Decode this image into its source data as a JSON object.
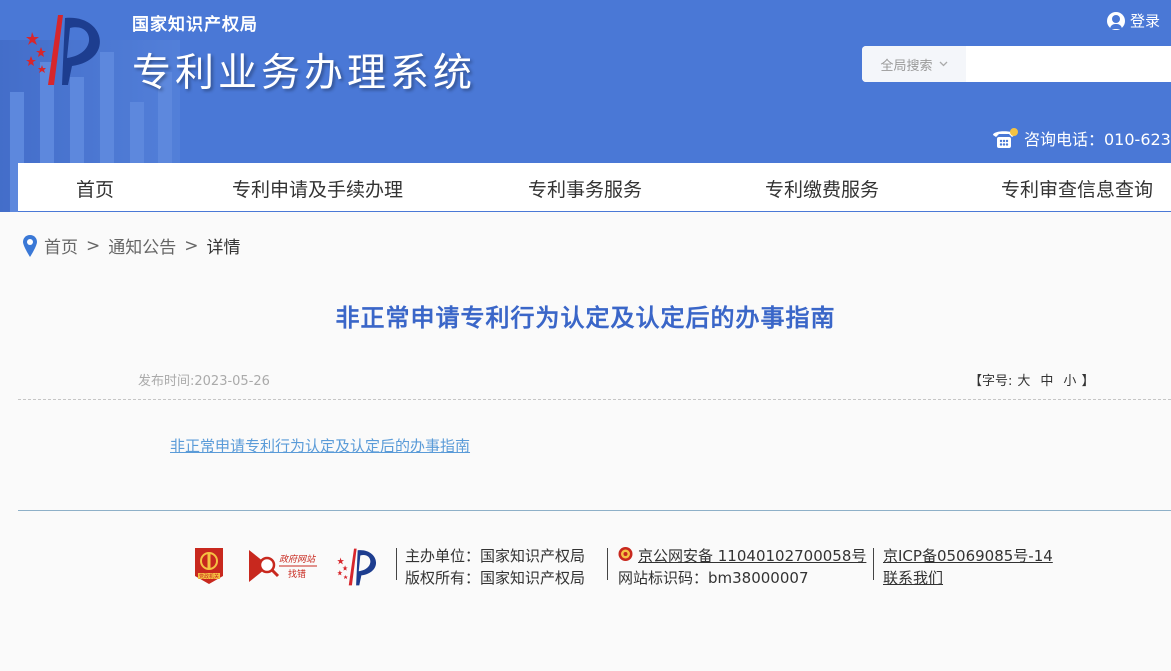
{
  "header": {
    "org_name": "国家知识产权局",
    "system_name": "专利业务办理系统",
    "login_label": "登录",
    "search": {
      "scope_label": "全局搜索",
      "placeholder": ""
    },
    "phone_label": "咨询电话：010-623"
  },
  "nav": {
    "items": [
      {
        "label": "首页"
      },
      {
        "label": "专利申请及手续办理"
      },
      {
        "label": "专利事务服务"
      },
      {
        "label": "专利缴费服务"
      },
      {
        "label": "专利审查信息查询"
      }
    ]
  },
  "breadcrumb": {
    "home": "首页",
    "section": "通知公告",
    "current": "详情",
    "separator": ">"
  },
  "article": {
    "title": "非正常申请专利行为认定及认定后的办事指南",
    "publish_time": "发布时间:2023-05-26",
    "font_size": {
      "prefix": "【字号:",
      "large": "大",
      "medium": "中",
      "small": "小",
      "suffix": "】"
    },
    "attachment_link": "非正常申请专利行为认定及认定后的办事指南"
  },
  "footer": {
    "badge_party": "党政机关",
    "badge_error_top": "政府网站",
    "badge_error_bottom": "找错",
    "sponsor": "主办单位：国家知识产权局",
    "copyright": "版权所有：国家知识产权局",
    "police_record": "京公网安备 11040102700058号",
    "site_code": "网站标识码：bm38000007",
    "icp": "京ICP备05069085号-14",
    "contact": "联系我们"
  },
  "colors": {
    "header_blue": "#4a78d6",
    "title_blue": "#3a66c8",
    "link_blue": "#5a9bd8"
  }
}
